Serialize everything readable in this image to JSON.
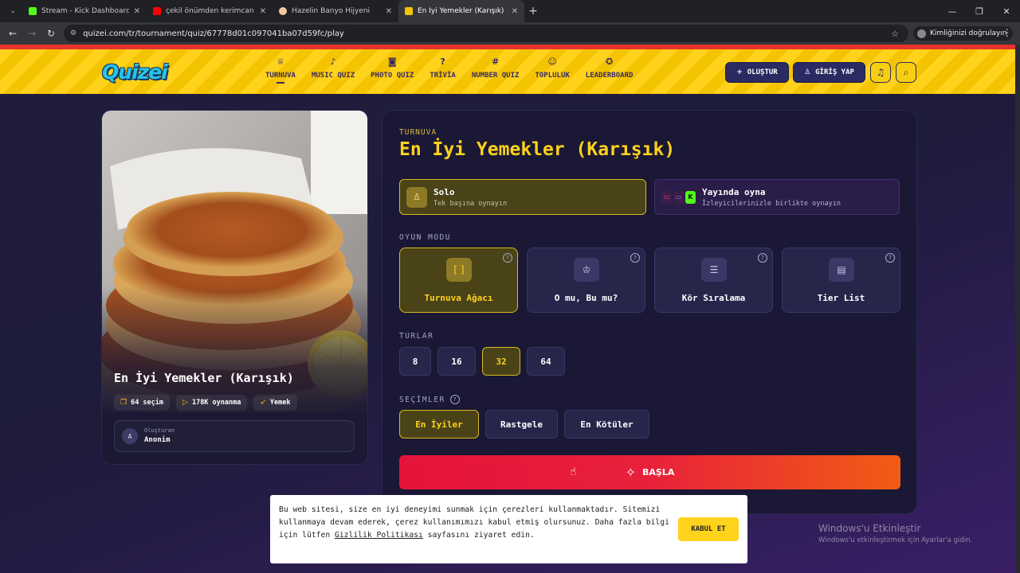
{
  "browser": {
    "tabs": [
      {
        "title": "Stream - Kick Dashboard",
        "icon_color": "#53fc18",
        "active": false
      },
      {
        "title": "çekil önümden kerimcan durmaz",
        "icon_color": "#ff0000",
        "active": false
      },
      {
        "title": "Hazelin Banyo Hijyeni",
        "icon_color": "#f3c89a",
        "active": false
      },
      {
        "title": "En İyi Yemekler (Karışık) - Tier L",
        "icon_color": "#f5c400",
        "active": true
      }
    ],
    "url": "quizei.com/tr/tournament/quiz/67778d01c097041ba07d59fc/play",
    "profile_label": "Kimliğinizi doğrulayın"
  },
  "header": {
    "logo": "Quizei",
    "nav": [
      {
        "label": "TURNUVA",
        "icon": "trophy-icon"
      },
      {
        "label": "MUSIC QUIZ",
        "icon": "music-note-icon"
      },
      {
        "label": "PHOTO QUIZ",
        "icon": "camera-icon"
      },
      {
        "label": "TRİVİA",
        "icon": "question-icon"
      },
      {
        "label": "NUMBER QUIZ",
        "icon": "hash-icon"
      },
      {
        "label": "TOPLULUK",
        "icon": "users-icon"
      },
      {
        "label": "LEADERBOARD",
        "icon": "medal-icon"
      }
    ],
    "create_label": "OLUŞTUR",
    "login_label": "GİRİŞ YAP"
  },
  "quiz": {
    "title": "En İyi Yemekler (Karışık)",
    "chips": [
      {
        "icon": "stack-icon",
        "label": "64 seçim"
      },
      {
        "icon": "play-icon",
        "label": "178K oynanma"
      },
      {
        "icon": "tag-icon",
        "label": "Yemek"
      }
    ],
    "author_label": "Oluşturan",
    "author_name": "Anonim",
    "author_initial": "A"
  },
  "panel": {
    "eyebrow": "TURNUVA",
    "title": "En İyi Yemekler (Karışık)",
    "play_modes": [
      {
        "title": "Solo",
        "subtitle": "Tek başına oynayın"
      },
      {
        "title": "Yayında oyna",
        "subtitle": "İzleyicilerinizle birlikte oynayın"
      }
    ],
    "game_mode_label": "OYUN MODU",
    "game_modes": [
      {
        "label": "Turnuva Ağacı",
        "icon": "bracket-icon"
      },
      {
        "label": "O mu, Bu mu?",
        "icon": "crown-icon"
      },
      {
        "label": "Kör Sıralama",
        "icon": "list-ordered-icon"
      },
      {
        "label": "Tier List",
        "icon": "table-rows-icon"
      }
    ],
    "rounds_label": "TURLAR",
    "rounds": [
      "8",
      "16",
      "32",
      "64"
    ],
    "selected_round": "32",
    "choices_label": "SEÇİMLER",
    "choices": [
      "En İyiler",
      "Rastgele",
      "En Kötüler"
    ],
    "start_label": "BAŞLA"
  },
  "cookie": {
    "text_before": "Bu web sitesi, size en iyi deneyimi sunmak için çerezleri kullanmaktadır. Sitemizi kullanmaya devam ederek, çerez kullanımımızı kabul etmiş olursunuz. Daha fazla bilgi için lütfen ",
    "link": "Gizlilik Politikası",
    "text_after": " sayfasını ziyaret edin.",
    "accept_label": "KABUL ET"
  },
  "watermark": {
    "line1": "Windows'u Etkinleştir",
    "line2": "Windows'u etkinleştirmek için Ayarlar'a gidin."
  }
}
